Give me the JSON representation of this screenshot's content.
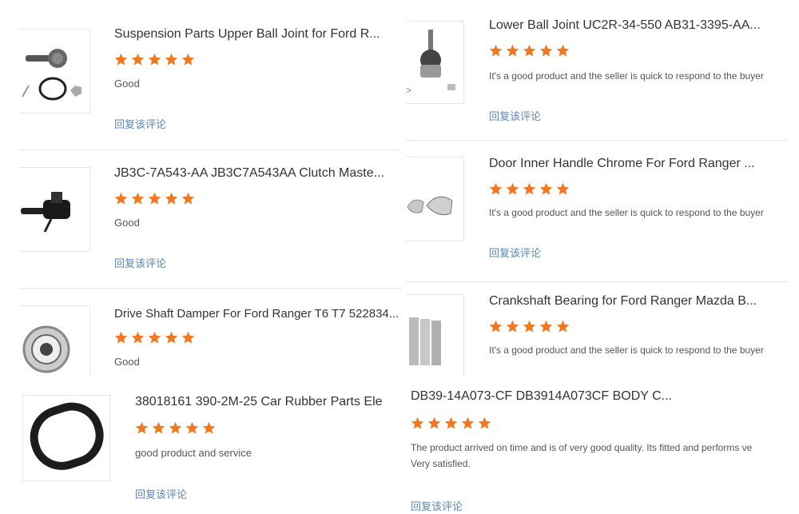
{
  "reviews": [
    {
      "title": "Suspension Parts Upper Ball Joint for Ford R...",
      "comment": "Good",
      "reply": "回复该评论",
      "image": "ball-joint-upper-image"
    },
    {
      "title": "Lower Ball Joint UC2R-34-550 AB31-3395-AA...",
      "comment": "It's a good product and the seller is quick to respond to the buyer",
      "reply": "回复该评论",
      "image": "ball-joint-lower-image"
    },
    {
      "title": "JB3C-7A543-AA JB3C7A543AA Clutch Maste...",
      "comment": "Good",
      "reply": "回复该评论",
      "image": "clutch-master-cylinder-image"
    },
    {
      "title": "Door Inner Handle Chrome For Ford Ranger ...",
      "comment": "It's a good product and the seller is quick to respond to the buyer",
      "reply": "回复该评论",
      "image": "door-handle-image"
    },
    {
      "title": "Drive Shaft Damper For Ford Ranger T6 T7 522834...",
      "comment": "Good",
      "image": "drive-shaft-damper-image"
    },
    {
      "title": "Crankshaft Bearing for Ford Ranger Mazda B...",
      "comment": "It's a good product and the seller is quick to respond to the buyer",
      "image": "crankshaft-bearing-image"
    },
    {
      "title": "38018161 390-2M-25 Car Rubber Parts Ele",
      "comment": "good product and service",
      "reply": "回复该评论",
      "image": "rubber-belt-image"
    },
    {
      "title": "DB39-14A073-CF DB3914A073CF BODY C...",
      "comment": "The product arrived on time and is of very good quality. Its fitted and performs ve",
      "comment2": "Very satisfied.",
      "reply": "回复该评论",
      "image": "body-control-module-image"
    }
  ],
  "rating": 5,
  "colors": {
    "star": "#f07821",
    "reply": "#5b86b3"
  }
}
